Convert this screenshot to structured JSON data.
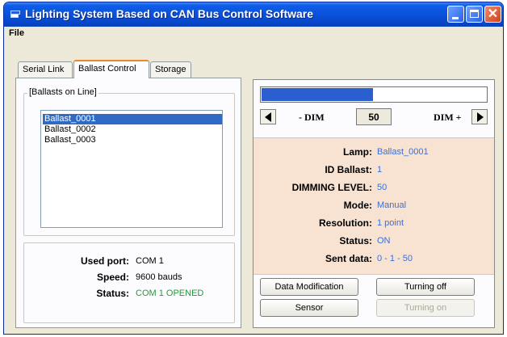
{
  "window": {
    "title": "Lighting System Based on CAN Bus Control Software",
    "menu": [
      "File"
    ]
  },
  "tabs": [
    {
      "label": "Serial Link",
      "active": false
    },
    {
      "label": "Ballast Control",
      "active": true
    },
    {
      "label": "Storage",
      "active": false
    }
  ],
  "ballasts": {
    "group_label": "[Ballasts on Line]",
    "items": [
      {
        "label": "Ballast_0001",
        "selected": true
      },
      {
        "label": "Ballast_0002",
        "selected": false
      },
      {
        "label": "Ballast_0003",
        "selected": false
      }
    ]
  },
  "port": {
    "used_port_label": "Used port:",
    "used_port": "COM 1",
    "speed_label": "Speed:",
    "speed": "9600 bauds",
    "status_label": "Status:",
    "status": "COM 1 OPENED",
    "status_color": "#1f9a3a"
  },
  "dimmer": {
    "minus_label": "- DIM",
    "plus_label": "DIM +",
    "value": "50",
    "progress_fraction": 0.5
  },
  "info": {
    "rows": [
      {
        "label": "Lamp:",
        "value": "Ballast_0001"
      },
      {
        "label": "ID Ballast:",
        "value": "1"
      },
      {
        "label": "DIMMING LEVEL:",
        "value": "50"
      },
      {
        "label": "Mode:",
        "value": "Manual"
      },
      {
        "label": "Resolution:",
        "value": "1 point"
      },
      {
        "label": "Status:",
        "value": "ON"
      },
      {
        "label": "Sent data:",
        "value": "0 - 1 - 50"
      }
    ],
    "value_color": "#3a6fd6",
    "background": "#f8e3d2"
  },
  "buttons": {
    "data_modification": "Data Modification",
    "turning_off": "Turning off",
    "sensor": "Sensor",
    "turning_on": "Turning on"
  },
  "colors": {
    "titlebar": "#0a4fd8",
    "selection": "#316ac5",
    "progress": "#2b5fcf"
  }
}
